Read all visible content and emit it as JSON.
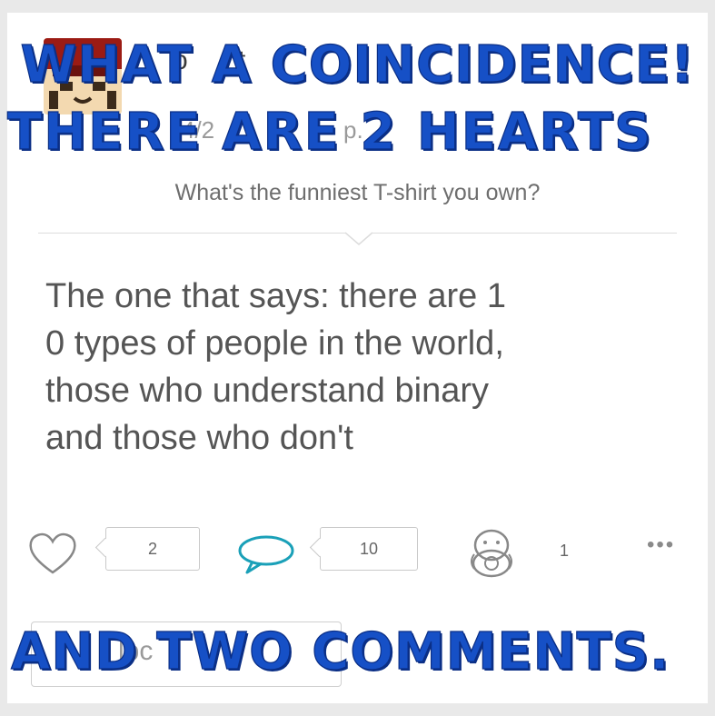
{
  "post": {
    "author_fragment": "o",
    "author_fragment_2": "t",
    "meta_fragment": "4/2",
    "meta_fragment_2": "p.",
    "question": "What's the funniest T-shirt you own?",
    "answer": "The one that says: there are 1\n0 types of people in the world,\nthose who understand binary\nand those who don't"
  },
  "actions": {
    "like_count": "2",
    "comment_count": "10",
    "share_count": "1",
    "more_label": "•••",
    "icons": [
      "heart-icon",
      "comment-bubble-icon",
      "pigeon-icon",
      "more-dots-icon"
    ],
    "comment_color": "#1aa0b8"
  },
  "reply": {
    "placeholder_fragment": "lpc"
  },
  "overlay_caption": {
    "line1": "WHAT A COINCIDENCE!",
    "line2": "THERE ARE 2 HEARTS",
    "line3": "AND TWO COMMENTS.",
    "color": "#1650c6"
  }
}
